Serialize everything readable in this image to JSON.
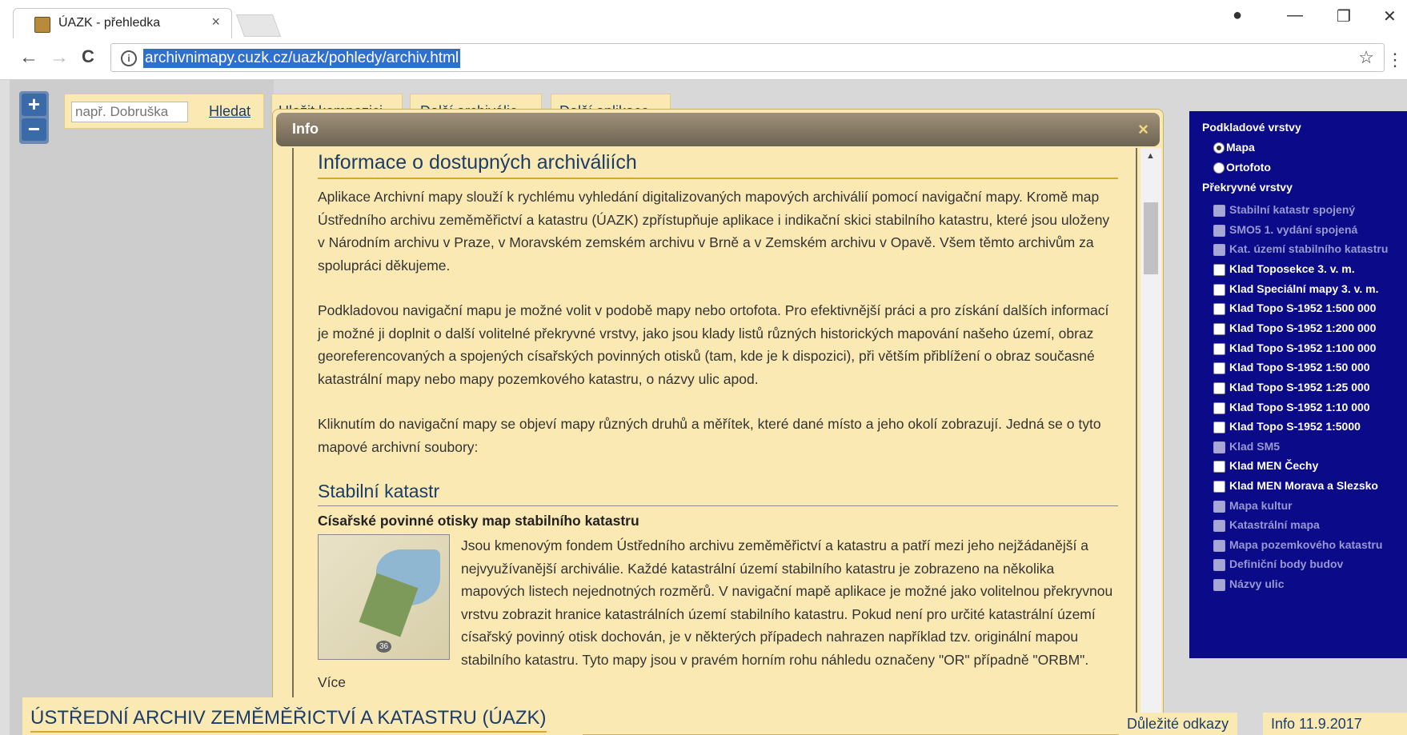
{
  "browser": {
    "tab_title": "ÚAZK - přehledka",
    "tab_close": "×",
    "url": "archivnimapy.cuzk.cz/uazk/pohledy/archiv.html",
    "back": "←",
    "forward": "→",
    "reload": "C",
    "bookmark": "☆",
    "menu": "⋮",
    "minimize": "—",
    "restore": "❐",
    "close": "✕",
    "profile": "●"
  },
  "map_tools": {
    "zoom_in": "+",
    "zoom_out": "−",
    "search_placeholder": "např. Dobruška",
    "search_button": "Hledat",
    "save_composition": "Uložit kompozici",
    "more_archives": "Další archiválie",
    "more_apps": "Další aplikace"
  },
  "dialog": {
    "title": "Info",
    "close": "×",
    "heading": "Informace o dostupných archiváliích",
    "paragraphs": [
      "Aplikace Archivní mapy slouží k rychlému vyhledání digitalizovaných mapových archiválií pomocí navigační mapy. Kromě map Ústředního archivu zeměměřictví a katastru (ÚAZK) zpřístupňuje aplikace i indikační skici stabilního katastru, které jsou uloženy v Národním archivu v Praze, v Moravském zemském archivu v Brně a v Zemském archivu v Opavě. Všem těmto archivům za spolupráci děkujeme.",
      "Podkladovou navigační mapu je možné volit v podobě mapy nebo ortofota. Pro efektivnější práci a pro získání dalších informací je možné ji doplnit o další volitelné překryvné vrstvy, jako jsou klady listů různých historických mapování našeho území, obraz georeferencovaných a spojených císařských povinných otisků (tam, kde je k dispozici), při větším přiblížení o obraz současné katastrální mapy nebo mapy pozemkového katastru, o názvy ulic apod.",
      "Kliknutím do navigační mapy se objeví mapy různých druhů a měřítek, které dané místo a jeho okolí zobrazují. Jedná se o tyto mapové archivní soubory:"
    ],
    "section_heading": "Stabilní katastr",
    "subsection_heading": "Císařské povinné otisky map stabilního katastru",
    "thumb_page": "36",
    "section_text": "Jsou kmenovým fondem Ústředního archivu zeměměřictví a katastru a patří mezi jeho nejžádanější a nejvyužívanější archiválie. Každé katastrální území stabilního katastru je zobrazeno na několika mapových listech nejednotných rozměrů. V navigační mapě aplikace je možné jako volitelnou překryvnou vrstvu zobrazit hranice katastrálních území stabilního katastru. Pokud není pro určité katastrální území císařský povinný otisk dochován, je v některých případech nahrazen například tzv. originální mapou stabilního katastru. Tyto mapy jsou v pravém horním rohu náhledu označeny \"OR\" případně \"ORBM\". Více"
  },
  "layers": {
    "base_heading": "Podkladové vrstvy",
    "base": [
      {
        "label": "Mapa",
        "selected": true
      },
      {
        "label": "Ortofoto",
        "selected": false
      }
    ],
    "overlay_heading": "Překryvné vrstvy",
    "overlays": [
      {
        "label": "Stabilní katastr spojený",
        "enabled": false
      },
      {
        "label": "SMO5 1. vydání spojená",
        "enabled": false
      },
      {
        "label": "Kat. území stabilního katastru",
        "enabled": false
      },
      {
        "label": "Klad Toposekce 3. v. m.",
        "enabled": true
      },
      {
        "label": "Klad Speciální mapy 3. v. m.",
        "enabled": true
      },
      {
        "label": "Klad Topo S-1952 1:500 000",
        "enabled": true
      },
      {
        "label": "Klad Topo S-1952 1:200 000",
        "enabled": true
      },
      {
        "label": "Klad Topo S-1952 1:100 000",
        "enabled": true
      },
      {
        "label": "Klad Topo S-1952 1:50 000",
        "enabled": true
      },
      {
        "label": "Klad Topo S-1952 1:25 000",
        "enabled": true
      },
      {
        "label": "Klad Topo S-1952 1:10 000",
        "enabled": true
      },
      {
        "label": "Klad Topo S-1952 1:5000",
        "enabled": true
      },
      {
        "label": "Klad SM5",
        "enabled": false
      },
      {
        "label": "Klad MEN Čechy",
        "enabled": true
      },
      {
        "label": "Klad MEN Morava a Slezsko",
        "enabled": true
      },
      {
        "label": "Mapa kultur",
        "enabled": false
      },
      {
        "label": "Katastrální mapa",
        "enabled": false
      },
      {
        "label": "Mapa pozemkového katastru",
        "enabled": false
      },
      {
        "label": "Definiční body budov",
        "enabled": false
      },
      {
        "label": "Názvy ulic",
        "enabled": false
      }
    ]
  },
  "footer": {
    "title": "ÚSTŘEDNÍ ARCHIV ZEMĚMĚŘICTVÍ A KATASTRU (ÚAZK)",
    "important_links": "Důležité odkazy",
    "info_date": "Info 11.9.2017"
  }
}
